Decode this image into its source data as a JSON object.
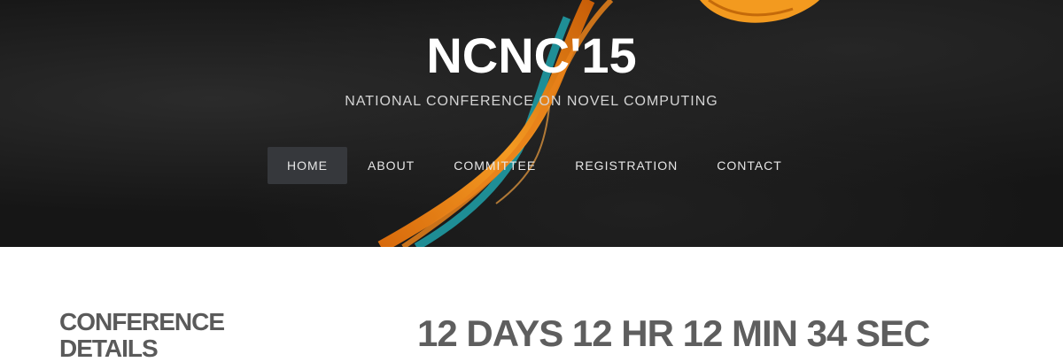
{
  "header": {
    "title": "NCNC'15",
    "tagline": "NATIONAL CONFERENCE ON NOVEL COMPUTING"
  },
  "nav": {
    "items": [
      {
        "label": "HOME",
        "active": true
      },
      {
        "label": "ABOUT",
        "active": false
      },
      {
        "label": "COMMITTEE",
        "active": false
      },
      {
        "label": "REGISTRATION",
        "active": false
      },
      {
        "label": "CONTACT",
        "active": false
      }
    ]
  },
  "main": {
    "section_heading": "CONFERENCE DETAILS",
    "countdown": "12 DAYS 12 HR 12 MIN 34 SEC"
  },
  "colors": {
    "hero_background": "#161616",
    "accent_orange": "#f08c1a",
    "accent_teal": "#1f9aa3",
    "nav_active_bg": "#36383c",
    "heading_text": "#5a5a5a"
  }
}
